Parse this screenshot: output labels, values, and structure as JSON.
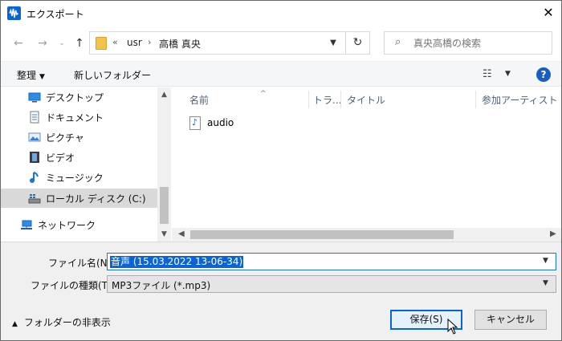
{
  "window": {
    "title": "エクスポート",
    "close_label": "✕"
  },
  "address_bar": {
    "overflow": "«",
    "crumbs": [
      "usr",
      "高橋 真央"
    ],
    "separator": "›",
    "refresh_label": "↻"
  },
  "search": {
    "placeholder": "真央高橋の検索"
  },
  "toolbar": {
    "organize_label": "整理",
    "new_folder_label": "新しいフォルダー",
    "help_label": "?"
  },
  "nav_pane": {
    "items": [
      {
        "label": "デスクトップ",
        "icon": "desktop-icon"
      },
      {
        "label": "ドキュメント",
        "icon": "document-icon"
      },
      {
        "label": "ピクチャ",
        "icon": "pictures-icon"
      },
      {
        "label": "ビデオ",
        "icon": "video-icon"
      },
      {
        "label": "ミュージック",
        "icon": "music-icon"
      },
      {
        "label": "ローカル ディスク (C:)",
        "icon": "drive-icon",
        "selected": true
      }
    ],
    "network_label": "ネットワーク"
  },
  "columns": [
    "名前",
    "トラ...",
    "タイトル",
    "参加アーティスト"
  ],
  "files": [
    {
      "name": "audio",
      "icon": "audio-file-icon"
    }
  ],
  "form": {
    "filename_label": "ファイル名(N):",
    "filename_value": "音声 (15.03.2022 13-06-34)",
    "filetype_label": "ファイルの種類(T):",
    "filetype_value": "MP3ファイル (*.mp3)"
  },
  "footer": {
    "hide_folders_label": "フォルダーの非表示",
    "save_label": "保存(S)",
    "cancel_label": "キャンセル"
  },
  "colors": {
    "accent": "#0a64d8",
    "selection": "#d9d9d9",
    "help": "#1a5fbf"
  }
}
